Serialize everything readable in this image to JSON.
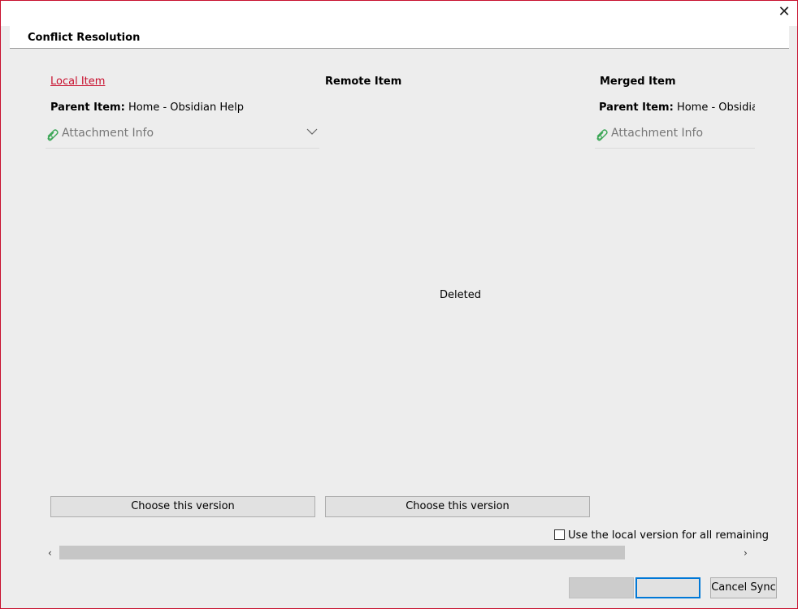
{
  "window": {
    "close_glyph": "✕",
    "header_title": "Conflict Resolution"
  },
  "columns": {
    "local": {
      "title": "Local Item",
      "parent_label": "Parent Item:",
      "parent_value": "Home - Obsidian Help",
      "attachment_label": "Attachment Info"
    },
    "remote": {
      "title": "Remote Item",
      "status": "Deleted"
    },
    "merged": {
      "title": "Merged Item",
      "parent_label": "Parent Item:",
      "parent_value": "Home - Obsidian H",
      "attachment_label": "Attachment Info"
    }
  },
  "buttons": {
    "choose_local": "Choose this version",
    "choose_remote": "Choose this version",
    "cancel_sync": "Cancel Sync"
  },
  "options": {
    "use_local_all_label": "Use the local version for all remaining",
    "use_local_all_checked": false
  },
  "scrollbar": {
    "left_glyph": "‹",
    "right_glyph": "›"
  },
  "colors": {
    "accent_red": "#c8102e",
    "focus_blue": "#0078d7",
    "attachment_icon_green": "#3aa655"
  },
  "icons": {
    "attachment": "paperclip-icon",
    "expand": "chevron-down-icon",
    "close": "close-icon"
  }
}
